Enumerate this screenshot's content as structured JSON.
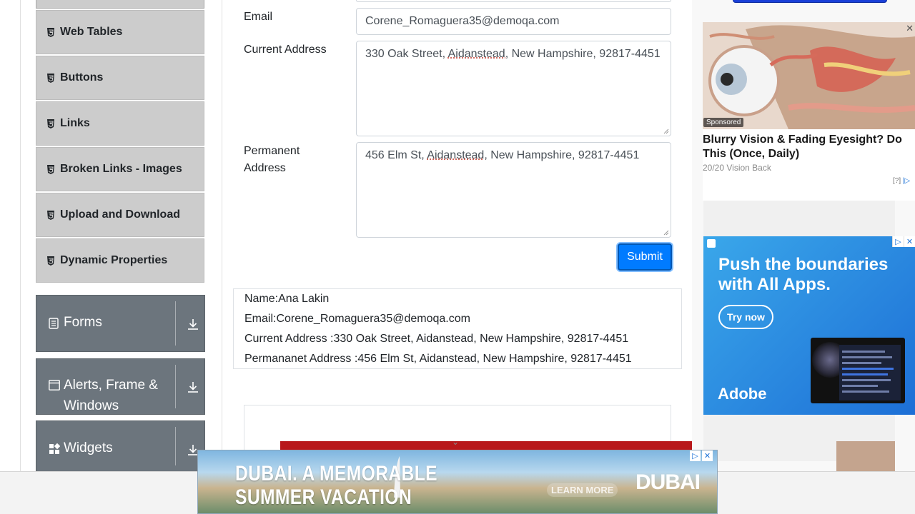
{
  "sidebar": {
    "elements_items": [
      {
        "label": "Web Tables"
      },
      {
        "label": "Buttons"
      },
      {
        "label": "Links"
      },
      {
        "label": "Broken Links - Images"
      },
      {
        "label": "Upload and Download"
      },
      {
        "label": "Dynamic Properties"
      }
    ],
    "groups": [
      {
        "label": "Forms",
        "icon": "document-icon"
      },
      {
        "label_line1": "Alerts, Frame &",
        "label_line2": "Windows",
        "icon": "window-icon"
      },
      {
        "label": "Widgets",
        "icon": "widgets-icon"
      }
    ]
  },
  "form": {
    "email_label": "Email",
    "email_value": "Corene_Romaguera35@demoqa.com",
    "current_address_label": "Current Address",
    "current_address": {
      "before": "330 Oak Street, ",
      "city": "Aidanstead,",
      "after": " New Hampshire, 92817-4451"
    },
    "permanent_address_label_line1": "Permanent",
    "permanent_address_label_line2": "Address",
    "permanent_address": {
      "before": "456 Elm St, ",
      "city": "Aidanstead",
      "after": ", New Hampshire, 92817-4451"
    },
    "submit_label": "Submit"
  },
  "output": {
    "name": "Name:Ana Lakin",
    "email": "Email:Corene_Romaguera35@demoqa.com",
    "current_address": "Current Address :330 Oak Street, Aidanstead, New Hampshire, 92817-4451",
    "permanent_address": "Permananet Address :456 Elm St, Aidanstead, New Hampshire, 92817-4451"
  },
  "ads": {
    "sponsored": {
      "tag": "Sponsored",
      "headline": "Blurry Vision & Fading Eyesight? Do This (Once, Daily)",
      "source": "20/20 Vision Back",
      "info": "[?]"
    },
    "adobe": {
      "headline": "Push the boundaries with All Apps.",
      "cta": "Try now",
      "brand": "Adobe"
    },
    "dubai": {
      "headline_line1": "DUBAI. A MEMORABLE",
      "headline_line2": "SUMMER VACATION",
      "cta": "LEARN MORE",
      "brand": "DUBAI"
    }
  },
  "colors": {
    "menu_item_bg": "#cccccc",
    "group_header_bg": "#6c757d",
    "submit_bg": "#007bff",
    "red_banner": "#b8181b"
  }
}
